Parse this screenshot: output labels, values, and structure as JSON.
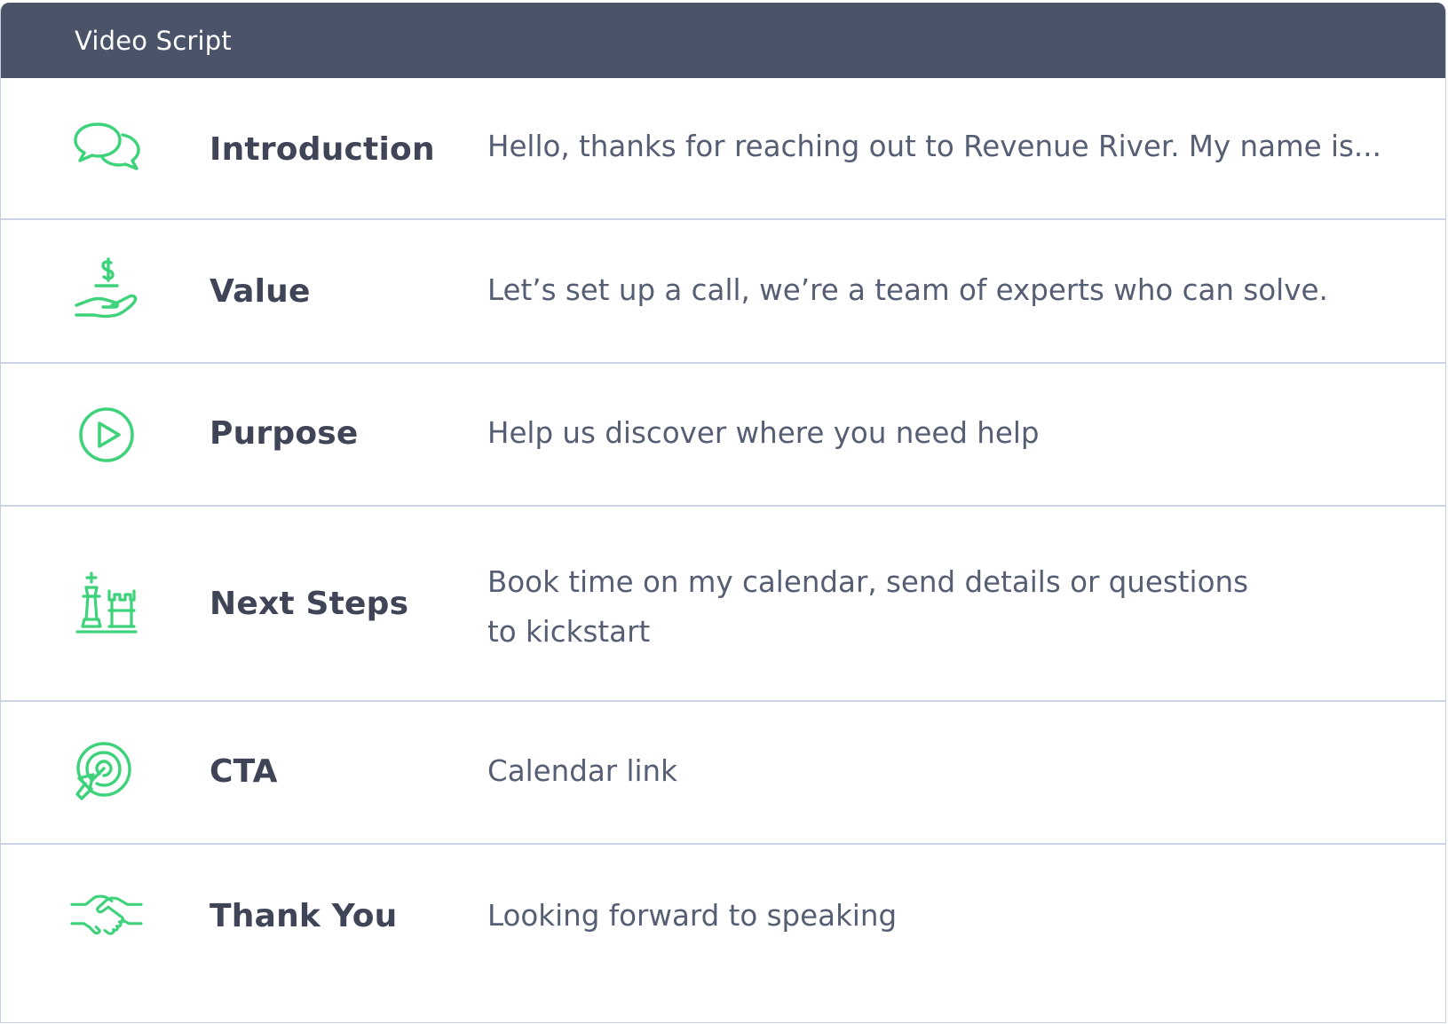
{
  "header": {
    "title": "Video Script"
  },
  "colors": {
    "header_bg": "#4a5368",
    "icon_accent": "#3ed27a",
    "divider": "#ccd3e6",
    "title_text": "#3f4557",
    "body_text": "#565e74"
  },
  "rows": [
    {
      "icon": "chat-bubbles-icon",
      "title": "Introduction",
      "lines": [
        "Hello, thanks for reaching out to Revenue River. My name is..."
      ]
    },
    {
      "icon": "hand-dollar-icon",
      "title": "Value",
      "lines": [
        "Let’s set up a call, we’re a team of experts who can solve."
      ]
    },
    {
      "icon": "play-circle-icon",
      "title": "Purpose",
      "lines": [
        "Help us discover where you need help"
      ]
    },
    {
      "icon": "chess-pieces-icon",
      "title": "Next Steps",
      "lines": [
        "Book time on my calendar, send details or questions",
        "to kickstart"
      ]
    },
    {
      "icon": "target-cursor-icon",
      "title": "CTA",
      "lines": [
        "Calendar link"
      ]
    },
    {
      "icon": "handshake-icon",
      "title": "Thank You",
      "lines": [
        "Looking forward to speaking"
      ]
    }
  ]
}
